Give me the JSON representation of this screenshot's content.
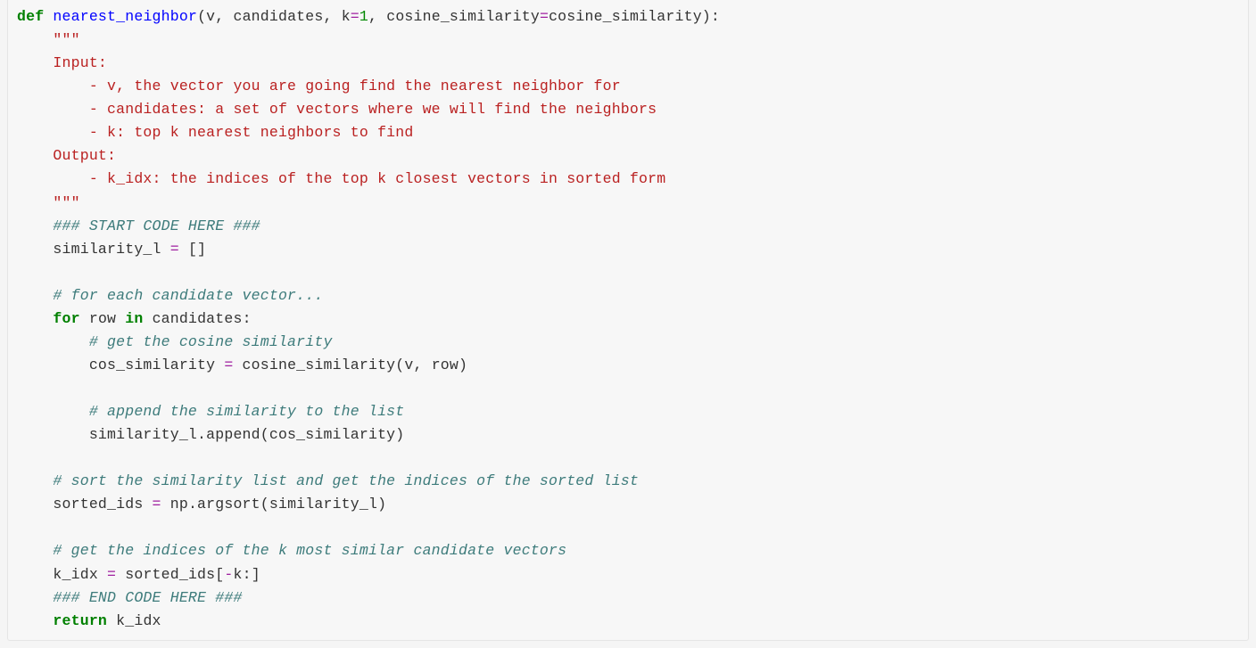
{
  "code": {
    "l1_def": "def",
    "l1_fn": "nearest_neighbor",
    "l1_open": "(v, candidates, k",
    "l1_eq1": "=",
    "l1_one": "1",
    "l1_mid": ", cosine_similarity",
    "l1_eq2": "=",
    "l1_rest": "cosine_similarity):",
    "doc_open": "    \"\"\"",
    "doc_input": "    Input:",
    "doc_v": "        - v, the vector you are going find the nearest neighbor for",
    "doc_cand": "        - candidates: a set of vectors where we will find the neighbors",
    "doc_k": "        - k: top k nearest neighbors to find",
    "doc_output": "    Output:",
    "doc_kidx": "        - k_idx: the indices of the top k closest vectors in sorted form",
    "doc_close": "    \"\"\"",
    "c_start": "    ### START CODE HERE ###",
    "sim_l": "    similarity_l ",
    "sim_eq": "=",
    "sim_r": " []",
    "c_each": "    # for each candidate vector...",
    "for_ind": "    ",
    "for_kw": "for",
    "for_row": " row ",
    "in_kw": "in",
    "for_rest": " candidates:",
    "c_cos": "        # get the cosine similarity",
    "cos_l": "        cos_similarity ",
    "cos_eq": "=",
    "cos_r": " cosine_similarity(v, row)",
    "c_app": "        # append the similarity to the list",
    "app_line": "        similarity_l.append(cos_similarity)",
    "c_sort": "    # sort the similarity list and get the indices of the sorted list",
    "sort_l": "    sorted_ids ",
    "sort_eq": "=",
    "sort_r": " np.argsort(similarity_l)",
    "c_kidx": "    # get the indices of the k most similar candidate vectors",
    "kidx_l": "    k_idx ",
    "kidx_eq": "=",
    "kidx_r1": " sorted_ids[",
    "kidx_op": "-",
    "kidx_r2": "k:]",
    "c_end": "    ### END CODE HERE ###",
    "ret_ind": "    ",
    "ret_kw": "return",
    "ret_rest": " k_idx"
  }
}
